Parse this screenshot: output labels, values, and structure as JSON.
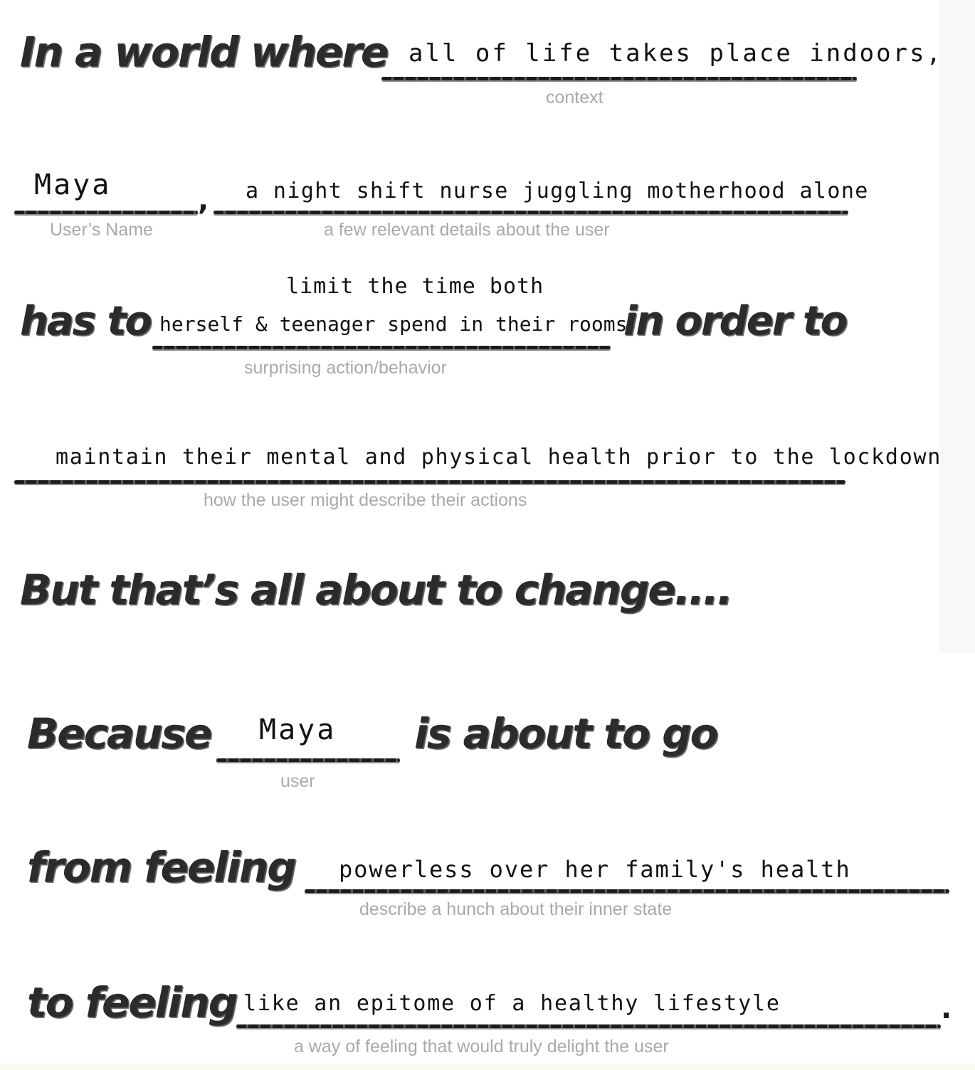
{
  "line1": {
    "heading": "In a world where",
    "answer": "all of life takes place indoors,",
    "hint": "context"
  },
  "line2": {
    "name_answer": "Maya",
    "comma": ",",
    "name_hint": "User’s Name",
    "details_answer": "a night shift nurse juggling motherhood alone",
    "details_hint": "a few relevant details about the user"
  },
  "line3": {
    "heading_left": "has to",
    "answer_top": "limit the time both",
    "answer_bottom": "herself & teenager spend in their rooms",
    "heading_right": "in order to",
    "hint": "surprising action/behavior"
  },
  "line4": {
    "answer": "maintain their mental and physical health prior to the lockdown",
    "hint": "how the user might describe their actions"
  },
  "line5": {
    "heading": "But that’s all about to change...."
  },
  "line6": {
    "heading_left": "Because",
    "answer": "Maya",
    "heading_right": "is about to go",
    "hint": "user"
  },
  "line7": {
    "heading": "from feeling",
    "answer": "powerless over her family's health",
    "hint": "describe a hunch about their inner state"
  },
  "line8": {
    "heading": "to feeling",
    "answer": "like an epitome of a healthy lifestyle",
    "period": ".",
    "hint": "a way of feeling that would truly delight the user"
  }
}
